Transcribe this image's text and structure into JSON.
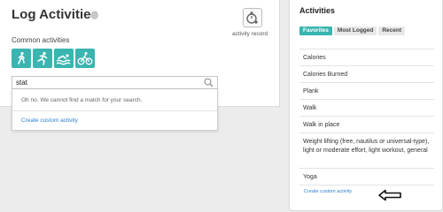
{
  "left": {
    "title": "Log Activities",
    "record_label": "activity record",
    "common_label": "Common activities",
    "activity_icons": [
      "walking-icon",
      "running-icon",
      "swimming-icon",
      "cycling-icon"
    ],
    "search": {
      "value": "stat"
    },
    "dropdown": {
      "no_match": "Oh no. We cannot find a match for your search.",
      "create_label": "Create custom activity"
    }
  },
  "right": {
    "title": "Activities",
    "tabs": [
      "Favorites",
      "Most Logged",
      "Recent"
    ],
    "active_tab": "Favorites",
    "favorites": [
      "Calories",
      "Calories Burned",
      "Plank",
      "Walk",
      "Walk in place",
      "Weight lifting (free, nautilus or universal-type), light or moderate effort, light workout, general",
      "Yoga"
    ],
    "create_label": "Create custom activity"
  },
  "colors": {
    "accent": "#3ab5b0",
    "link": "#2a7fd4"
  }
}
